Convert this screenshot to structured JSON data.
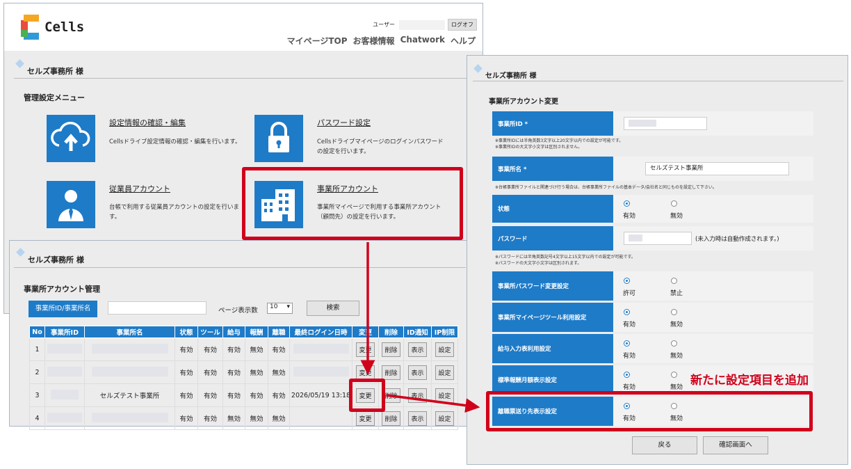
{
  "main": {
    "logo_text": "Cells",
    "user_label": "ユーザー",
    "logoff": "ログオフ",
    "nav": [
      "マイページTOP",
      "お客様情報",
      "Chatwork",
      "ヘルプ"
    ],
    "office_title": "セルズ事務所 様",
    "menu_heading": "管理設定メニュー",
    "menu_items": [
      {
        "link": "設定情報の確認・編集",
        "desc": "Cellsドライブ設定情報の確認・編集を行います。",
        "icon": "cloud-upload-icon"
      },
      {
        "link": "パスワード設定",
        "desc": "Cellsドライブマイページのログインパスワードの設定を行います。",
        "icon": "lock-icon"
      },
      {
        "link": "従業員アカウント",
        "desc": "台帳で利用する従業員アカウントの設定を行います。",
        "icon": "user-icon"
      },
      {
        "link": "事業所アカウント",
        "desc": "事業所マイページで利用する事業所アカウント（顧問先）の設定を行います。",
        "icon": "building-icon"
      }
    ]
  },
  "list": {
    "office_title": "セルズ事務所 様",
    "heading": "事業所アカウント管理",
    "search_label": "事業所ID/事業所名",
    "perpage_label": "ページ表示数",
    "perpage_value": "10",
    "search_button": "検索",
    "columns": [
      "No",
      "事業所ID",
      "事業所名",
      "状態",
      "ツール",
      "給与",
      "報酬",
      "離職",
      "最終ログイン日時",
      "変更",
      "削除",
      "ID通知",
      "IP制限"
    ],
    "rows": [
      {
        "no": "1",
        "name": "",
        "state": "有効",
        "tool": "有効",
        "pay": "有効",
        "fee": "無効",
        "leave": "有効",
        "login": ""
      },
      {
        "no": "2",
        "name": "",
        "state": "有効",
        "tool": "有効",
        "pay": "有効",
        "fee": "無効",
        "leave": "無効",
        "login": ""
      },
      {
        "no": "3",
        "name": "セルズテスト事業所",
        "state": "有効",
        "tool": "有効",
        "pay": "有効",
        "fee": "有効",
        "leave": "有効",
        "login": "2026/05/19 13:18"
      },
      {
        "no": "4",
        "name": "",
        "state": "有効",
        "tool": "有効",
        "pay": "無効",
        "fee": "無効",
        "leave": "無効",
        "login": ""
      }
    ],
    "btn_change": "変更",
    "btn_delete": "削除",
    "btn_show": "表示",
    "btn_setting": "設定"
  },
  "edit": {
    "office_title": "セルズ事務所 様",
    "heading": "事業所アカウント変更",
    "office_id_label": "事業所ID *",
    "office_id_note1": "※事業所IDには半角英数3文字以上20文字以内での設定が可能です。",
    "office_id_note2": "※事業所IDの大文字小文字は区別されません。",
    "office_name_label": "事業所名 *",
    "office_name_value": "セルズテスト事業所",
    "office_name_note": "※台帳事業所ファイルと関連づけ行う場合は、台帳事業所ファイルの基本データ/会社名と同じものを設定して下さい。",
    "status_label": "状態",
    "password_label": "パスワード",
    "password_hint": "(未入力時は自動作成されます。)",
    "password_note1": "※パスワードには半角英数記号4文字以上15文字以内での設定が可能です。",
    "password_note2": "※パスワードの大文字小文字は区別されます。",
    "pw_change_label": "事業所パスワード変更設定",
    "tool_label": "事業所マイページツール利用設定",
    "payroll_label": "給与入力表利用設定",
    "monthly_label": "標準報酬月額表示設定",
    "leave_label": "離職票送り先表示設定",
    "enabled": "有効",
    "disabled": "無効",
    "allow": "許可",
    "deny": "禁止",
    "back_button": "戻る",
    "confirm_button": "確認画面へ"
  },
  "callout": "新たに設定項目を追加",
  "colors": {
    "accent": "#1e7bc8",
    "highlight": "#d0021b"
  }
}
